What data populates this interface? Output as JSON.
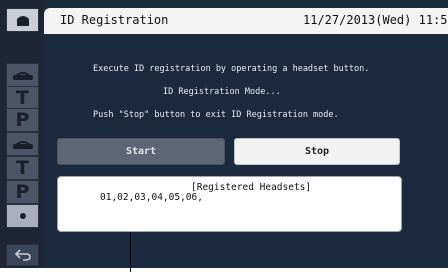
{
  "header": {
    "title": "ID Registration",
    "datetime": "11/27/2013(Wed)  11:58"
  },
  "messages": {
    "line1": "Execute ID registration by operating a headset button.",
    "line2": "ID Registration Mode...",
    "line3": "Push \"Stop\" button to exit ID Registration mode."
  },
  "buttons": {
    "start_label": "Start",
    "stop_label": "Stop"
  },
  "registered": {
    "title": "[Registered Headsets]",
    "list": "01,02,03,04,05,06,"
  },
  "sidebar": {
    "items": [
      {
        "icon": "home-icon"
      },
      {
        "icon": "headset-icon"
      },
      {
        "label": "T"
      },
      {
        "label": "P"
      },
      {
        "icon": "headset-icon"
      },
      {
        "label": "T"
      },
      {
        "label": "P"
      },
      {
        "icon": "dot-icon"
      }
    ],
    "back_icon": "back-arrow-icon"
  },
  "colors": {
    "background": "#1c2a40",
    "sidebar": "#1e2636",
    "titlebar": "#f4f4f4",
    "start_button": "#5d6672",
    "stop_button": "#f2f2f2"
  }
}
